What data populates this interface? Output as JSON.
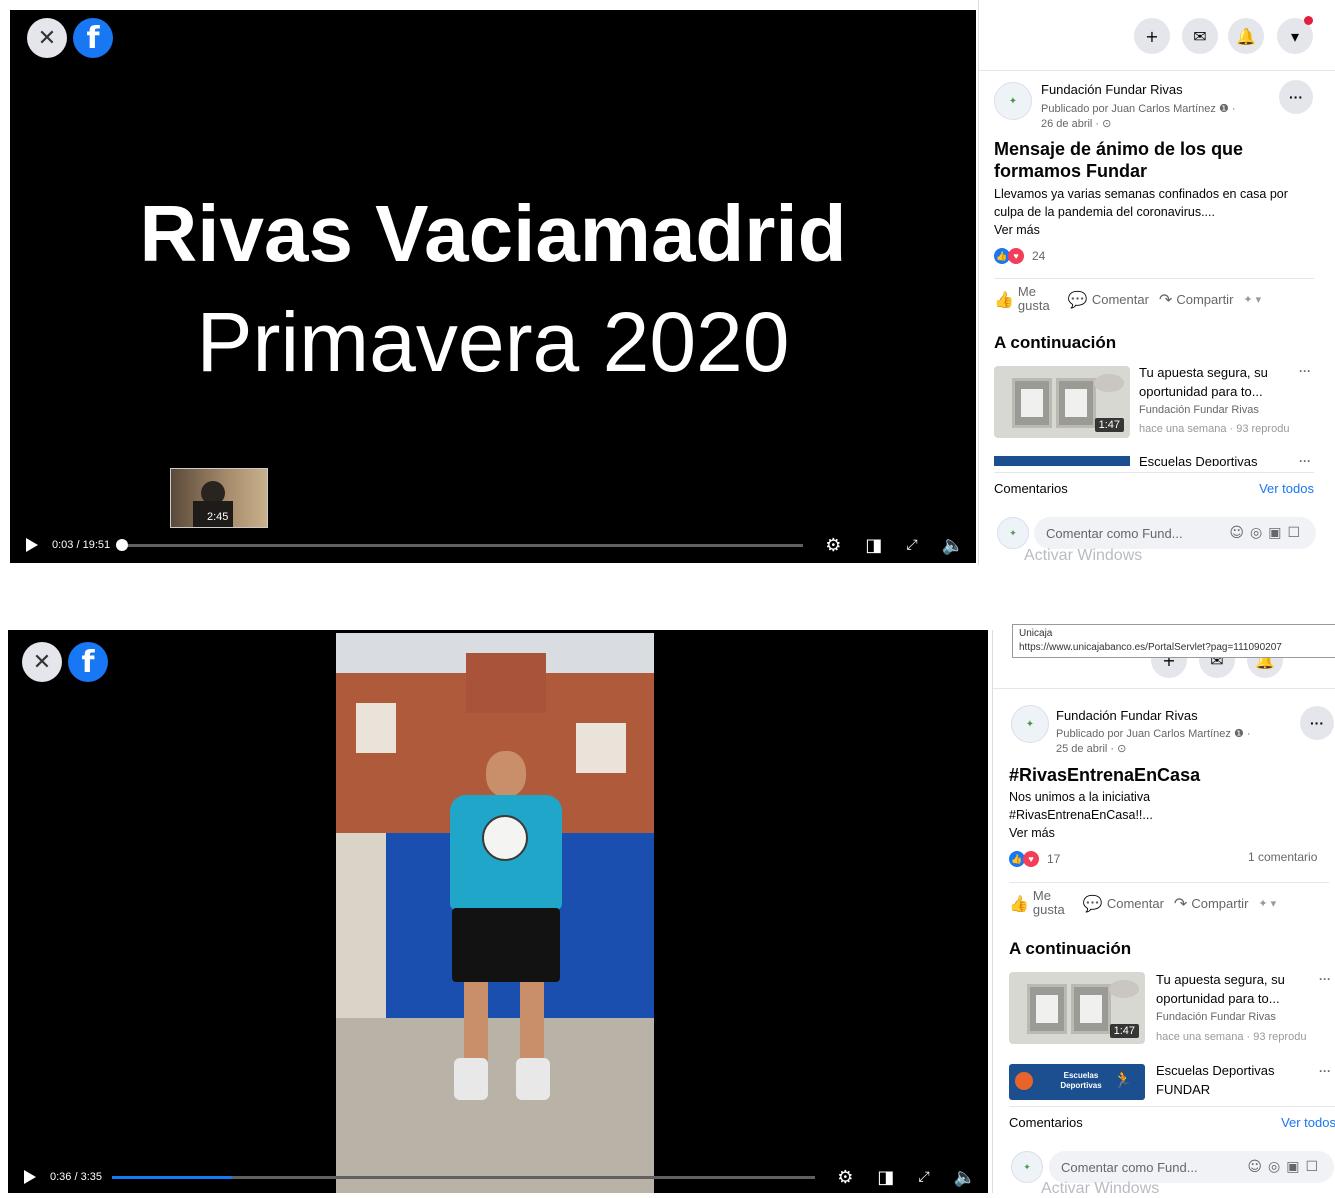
{
  "screen1": {
    "video": {
      "title_line1": "Rivas Vaciamadrid",
      "title_line2": "Primavera 2020",
      "preview_time": "2:45",
      "time": "0:03 / 19:51",
      "progress": 0.003
    },
    "side": {
      "page_name": "Fundación Fundar Rivas",
      "published_by": "Publicado por Juan Carlos Martínez",
      "date": "26 de abril ·",
      "post_title": "Mensaje de ánimo de los que formamos Fundar",
      "post_text": "Llevamos ya varias semanas confinados en casa por culpa de la pandemia del coronavirus....",
      "see_more": "Ver más",
      "reactions_count": "24",
      "like_label": "Me gusta",
      "comment_label": "Comentar",
      "share_label": "Compartir",
      "up_next_title": "A continuación",
      "rec1": {
        "title": "Tu apuesta segura, su oportunidad para to...",
        "page": "Fundación Fundar Rivas",
        "meta": "hace una semana · 93 reprodu",
        "duration": "1:47"
      },
      "rec2": {
        "title": "Escuelas Deportivas"
      },
      "comments_label": "Comentarios",
      "see_all": "Ver todos",
      "comment_placeholder": "Comentar como Fund...",
      "watermark": "Activar Windows"
    }
  },
  "screen2": {
    "video": {
      "time": "0:36 / 3:35",
      "progress": 0.17
    },
    "url_tooltip": {
      "line1": "Unicaja",
      "line2": "https://www.unicajabanco.es/PortalServlet?pag=111090207"
    },
    "side": {
      "page_name": "Fundación Fundar Rivas",
      "published_by": "Publicado por Juan Carlos Martínez",
      "date": "25 de abril ·",
      "post_title": "#RivasEntrenaEnCasa",
      "post_text_line1": "Nos unimos a la iniciativa",
      "post_text_line2": "#RivasEntrenaEnCasa!!...",
      "see_more": "Ver más",
      "reactions_count": "17",
      "comments_count": "1 comentario",
      "like_label": "Me gusta",
      "comment_label": "Comentar",
      "share_label": "Compartir",
      "up_next_title": "A continuación",
      "rec1": {
        "title": "Tu apuesta segura, su oportunidad para to...",
        "page": "Fundación Fundar Rivas",
        "meta": "hace una semana · 93 reprodu",
        "duration": "1:47"
      },
      "rec2": {
        "title": "Escuelas Deportivas FUNDAR",
        "thumb_text": "Escuelas Deportivas"
      },
      "comments_label": "Comentarios",
      "see_all": "Ver todos",
      "comment_placeholder": "Comentar como Fund...",
      "watermark": "Activar Windows"
    }
  },
  "icons": {
    "close": "close-icon",
    "facebook": "facebook-logo-icon",
    "plus": "plus-icon",
    "messenger": "messenger-icon",
    "notifications": "bell-icon",
    "account": "caret-down-icon",
    "settings": "gear-icon",
    "pip": "miniplayer-icon",
    "fullscreen": "expand-icon",
    "volume": "volume-icon"
  },
  "colors": {
    "facebook_blue": "#1877f2",
    "love_red": "#f33e58",
    "video_bg": "#000000"
  }
}
